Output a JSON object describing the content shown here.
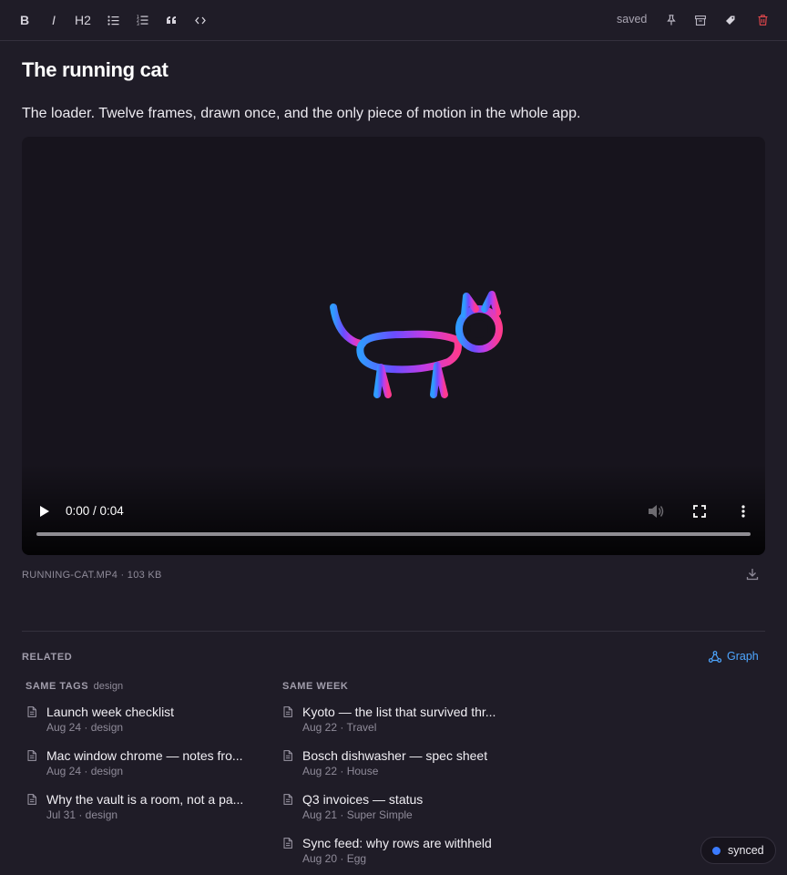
{
  "toolbar": {
    "bold": "B",
    "italic": "I",
    "heading": "H2",
    "saved": "saved"
  },
  "note": {
    "title": "The running cat",
    "intro": "The loader. Twelve frames, drawn once, and the only piece of motion in the whole app."
  },
  "video": {
    "time": "0:00 / 0:04",
    "progress": 0,
    "file_meta": "RUNNING-CAT.MP4 · 103 KB"
  },
  "related": {
    "label": "RELATED",
    "graph_label": "Graph",
    "same_tags_label": "SAME TAGS",
    "same_tags_tag": "design",
    "same_week_label": "SAME WEEK",
    "same_tags": [
      {
        "title": "Launch week checklist",
        "meta": "Aug 24 · design"
      },
      {
        "title": "Mac window chrome — notes fro...",
        "meta": "Aug 24 · design"
      },
      {
        "title": "Why the vault is a room, not a pa...",
        "meta": "Jul 31 · design"
      }
    ],
    "same_week": [
      {
        "title": "Kyoto — the list that survived thr...",
        "meta": "Aug 22 · Travel"
      },
      {
        "title": "Bosch dishwasher — spec sheet",
        "meta": "Aug 22 · House"
      },
      {
        "title": "Q3 invoices — status",
        "meta": "Aug 21 · Super Simple"
      },
      {
        "title": "Sync feed: why rows are withheld",
        "meta": "Aug 20 · Egg"
      }
    ]
  },
  "status": {
    "sync": "synced"
  },
  "colors": {
    "background": "#1f1c27",
    "accent_link": "#4ea6ff",
    "delete": "#e5484d",
    "sync_dot": "#3b7bff"
  }
}
